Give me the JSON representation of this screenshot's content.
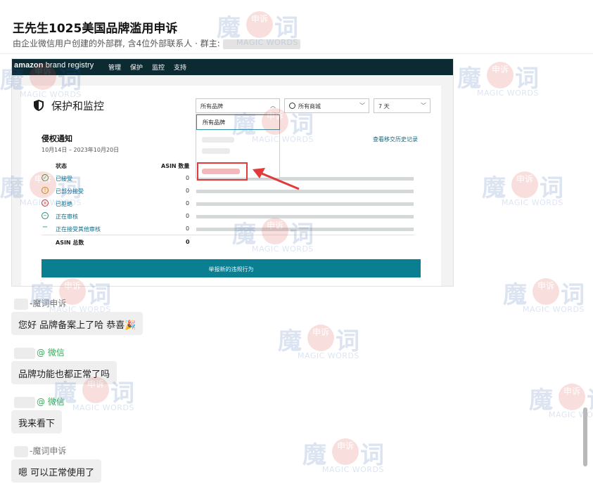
{
  "chat": {
    "title": "王先生1025美国品牌滥用申诉",
    "subtitle": "由企业微信用户创建的外部群, 含4位外部联系人 · 群主:"
  },
  "screenshot": {
    "brand": "brand registry",
    "brand_prefix": "amazon",
    "nav": [
      "管理",
      "保护",
      "监控",
      "支持"
    ],
    "page_title": "保护和监控",
    "filters": {
      "brand": "所有品牌",
      "marketplace": "所有商城",
      "period": "7 天"
    },
    "dropdown_selected": "所有品牌",
    "section_title": "侵权通知",
    "section_date": "10月14日 – 2023年10月20日",
    "history_link": "查看移交历史记录",
    "columns": {
      "status": "状态",
      "asin_count": "ASIN 数量"
    },
    "statuses": [
      {
        "label": "已接受",
        "count": "0",
        "icon": "check-icon",
        "color": "#3a8a3a"
      },
      {
        "label": "已部分接受",
        "count": "0",
        "icon": "warning-icon",
        "color": "#c79300"
      },
      {
        "label": "已拒绝",
        "count": "0",
        "icon": "cross-icon",
        "color": "#c8302e"
      },
      {
        "label": "正在审核",
        "count": "0",
        "icon": "minus-circle-icon",
        "color": "#2b8a7a"
      },
      {
        "label": "正在接受其他审核",
        "count": "0",
        "icon": "dash-icon",
        "color": "#2b8a7a"
      }
    ],
    "total_label": "ASIN 总数",
    "total_count": "0",
    "report_button": "举报新的违规行为"
  },
  "messages": [
    {
      "sender": "-魔词申诉",
      "tag": "",
      "text": "您好 品牌备案上了哈 恭喜🎉"
    },
    {
      "sender": "",
      "tag": "@ 微信",
      "text": "品牌功能也都正常了吗"
    },
    {
      "sender": "",
      "tag": "@ 微信",
      "text": "我来看下"
    },
    {
      "sender": "-魔词申诉",
      "tag": "",
      "text": "嗯 可以正常使用了"
    }
  ],
  "watermark": {
    "big_left": "魔",
    "ring": "申诉",
    "big_right": "词",
    "small": "MAGIC WORDS"
  },
  "colors": {
    "accent_teal": "#0b7f92",
    "amazon_dark": "#0c2a32",
    "highlight_red": "#e03a3a",
    "wechat_green": "#3da85d"
  }
}
